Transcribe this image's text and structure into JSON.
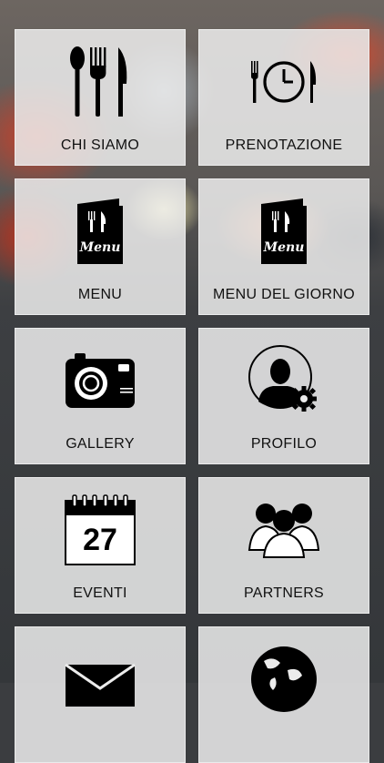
{
  "tiles": [
    {
      "label": "CHI SIAMO",
      "icon": "cutlery-icon"
    },
    {
      "label": "PRENOTAZIONE",
      "icon": "plate-clock-icon"
    },
    {
      "label": "MENU",
      "icon": "menu-book-icon"
    },
    {
      "label": "MENU DEL GIORNO",
      "icon": "menu-book-icon"
    },
    {
      "label": "GALLERY",
      "icon": "camera-icon"
    },
    {
      "label": "PROFILO",
      "icon": "user-gear-icon"
    },
    {
      "label": "EVENTI",
      "icon": "calendar-icon"
    },
    {
      "label": "PARTNERS",
      "icon": "group-icon"
    },
    {
      "label": "",
      "icon": "envelope-icon"
    },
    {
      "label": "",
      "icon": "globe-icon"
    }
  ],
  "menu_book_text": "Menu",
  "calendar_day": "27"
}
